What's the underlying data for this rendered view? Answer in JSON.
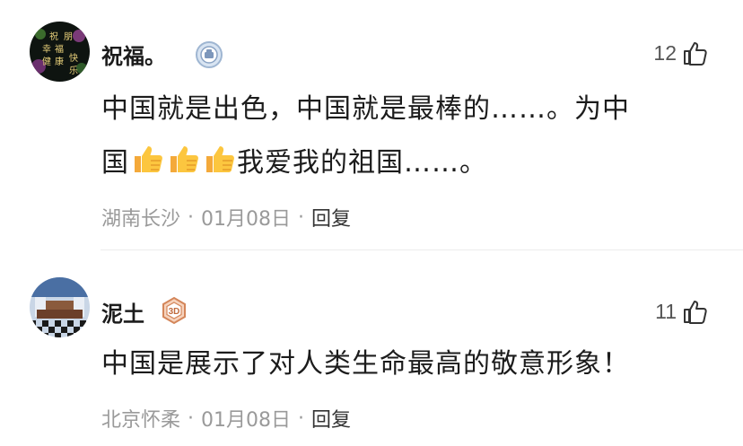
{
  "comments": [
    {
      "username": "祝福。",
      "avatar_text": [
        "祝",
        "朋",
        "幸",
        "福",
        "健",
        "康",
        "快",
        "乐"
      ],
      "badge_icon": "vip-medal-icon",
      "likes": "12",
      "content_line1": "中国就是出色，中国就是最棒的……。为中",
      "content_prefix": "国",
      "content_suffix": "我爱我的祖国……。",
      "emoji_count": 3,
      "location": "湖南长沙",
      "date": "01月08日",
      "reply_label": "回复"
    },
    {
      "username": "泥土",
      "badge_text": "3D",
      "likes": "11",
      "content": "中国是展示了对人类生命最高的敬意形象！",
      "location": "北京怀柔",
      "date": "01月08日",
      "reply_label": "回复"
    }
  ],
  "meta_separator": "·",
  "colors": {
    "text": "#1c1c1c",
    "meta": "#9a9a9a",
    "badge_bronze": "#d4865a"
  }
}
